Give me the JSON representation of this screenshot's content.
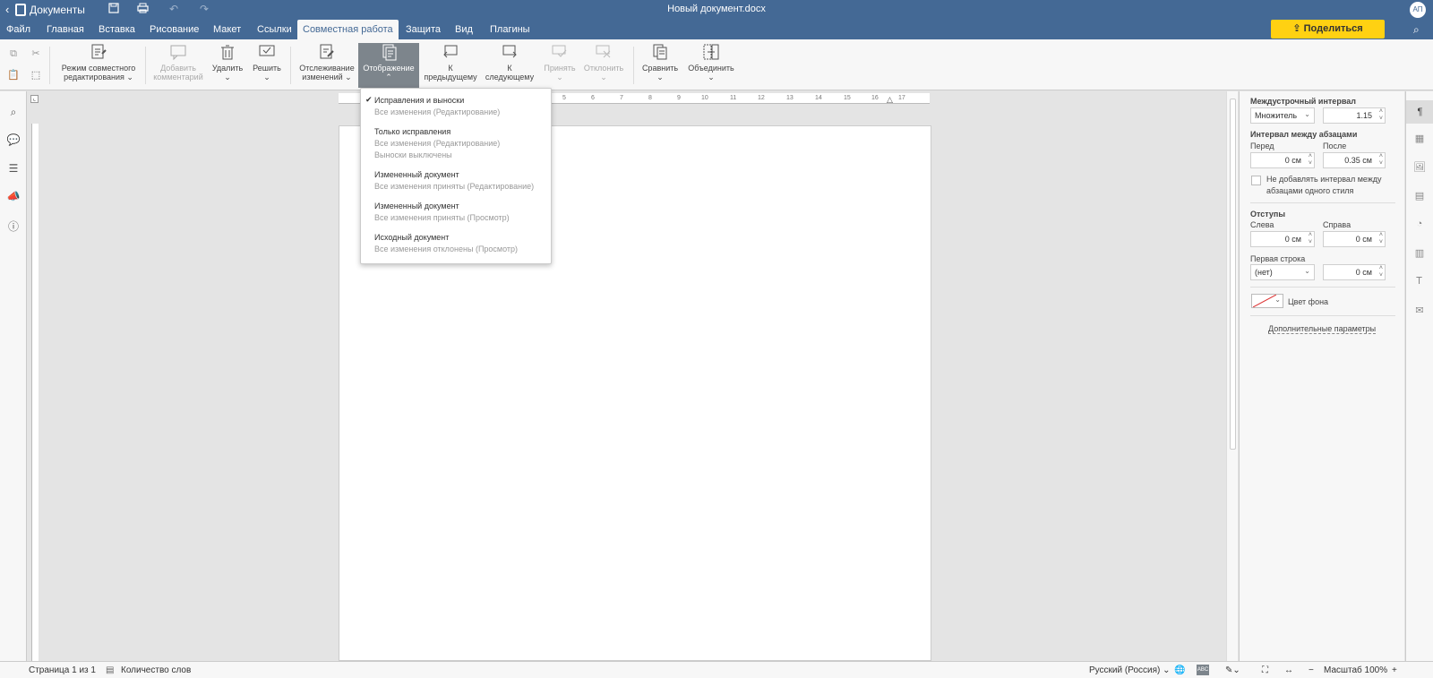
{
  "app": {
    "name": "Документы",
    "doc_title": "Новый документ.docx",
    "avatar": "АП",
    "share_label": "Поделиться"
  },
  "tabs": [
    "Файл",
    "Главная",
    "Вставка",
    "Рисование",
    "Макет",
    "Ссылки",
    "Совместная работа",
    "Защита",
    "Вид",
    "Плагины"
  ],
  "active_tab": "Совместная работа",
  "toolbar": {
    "coedit_l1": "Режим совместного",
    "coedit_l2": "редактирования",
    "add_comment_l1": "Добавить",
    "add_comment_l2": "комментарий",
    "delete": "Удалить",
    "resolve": "Решить",
    "track_l1": "Отслеживание",
    "track_l2": "изменений",
    "display": "Отображение",
    "prev_l1": "К",
    "prev_l2": "предыдущему",
    "next_l1": "К",
    "next_l2": "следующему",
    "accept": "Принять",
    "reject": "Отклонить",
    "compare": "Сравнить",
    "combine": "Объединить"
  },
  "display_menu": [
    {
      "title": "Исправления и выноски",
      "sub": [
        "Все изменения (Редактирование)"
      ],
      "checked": true
    },
    {
      "title": "Только исправления",
      "sub": [
        "Все изменения (Редактирование)",
        "Выноски выключены"
      ],
      "checked": false
    },
    {
      "title": "Измененный документ",
      "sub": [
        "Все изменения приняты (Редактирование)"
      ],
      "checked": false
    },
    {
      "title": "Измененный документ",
      "sub": [
        "Все изменения приняты (Просмотр)"
      ],
      "checked": false
    },
    {
      "title": "Исходный документ",
      "sub": [
        "Все изменения отклонены (Просмотр)"
      ],
      "checked": false
    }
  ],
  "ruler_ticks": [
    "5",
    "6",
    "7",
    "8",
    "9",
    "10",
    "11",
    "12",
    "13",
    "14",
    "15",
    "16",
    "17"
  ],
  "paragraph": {
    "line_spacing_label": "Междустрочный интервал",
    "line_spacing_type": "Множитель",
    "line_spacing_value": "1.15",
    "para_spacing_label": "Интервал между абзацами",
    "before_label": "Перед",
    "after_label": "После",
    "before_value": "0 см",
    "after_value": "0.35 см",
    "no_space_l1": "Не добавлять интервал между",
    "no_space_l2": "абзацами одного стиля",
    "indents_label": "Отступы",
    "left_label": "Слева",
    "right_label": "Справа",
    "left_value": "0 см",
    "right_value": "0 см",
    "first_line_label": "Первая строка",
    "first_line_type": "(нет)",
    "first_line_value": "0 см",
    "bg_color_label": "Цвет фона",
    "advanced_label": "Дополнительные параметры"
  },
  "status": {
    "page": "Страница 1 из 1",
    "word_count": "Количество слов",
    "language": "Русский (Россия)",
    "zoom": "Масштаб 100%"
  }
}
